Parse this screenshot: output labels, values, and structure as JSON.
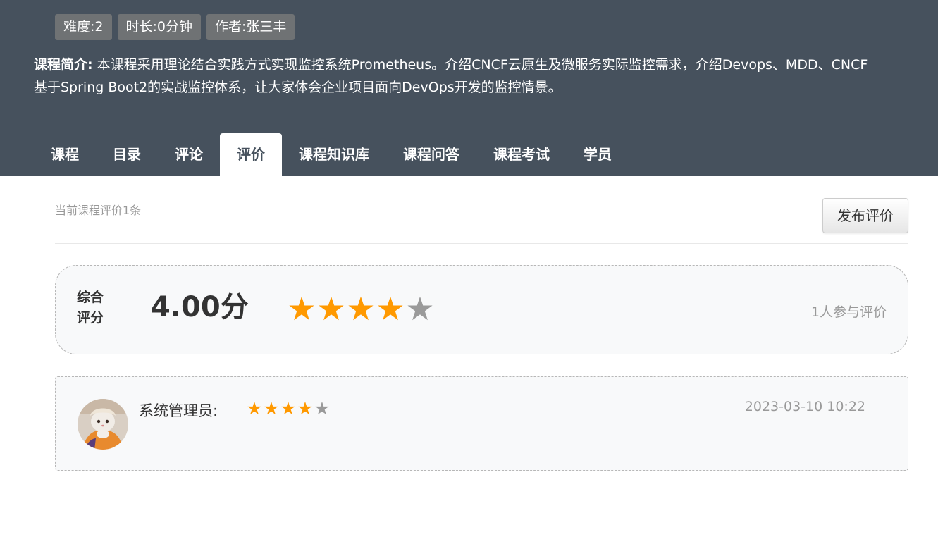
{
  "course": {
    "tags": [
      "难度:2",
      "时长:0分钟",
      "作者:张三丰"
    ],
    "intro_label": "课程简介:",
    "intro_line1": " 本课程采用理论结合实践方式实现监控系统Prometheus。介绍CNCF云原生及微服务实际监控需求，介绍Devops、MDD、CNCF",
    "intro_line2": "基于Spring Boot2的实战监控体系，让大家体会企业项目面向DevOps开发的监控情景。"
  },
  "tabs": [
    {
      "label": "课程",
      "active": false
    },
    {
      "label": "目录",
      "active": false
    },
    {
      "label": "评论",
      "active": false
    },
    {
      "label": "评价",
      "active": true
    },
    {
      "label": "课程知识库",
      "active": false
    },
    {
      "label": "课程问答",
      "active": false
    },
    {
      "label": "课程考试",
      "active": false
    },
    {
      "label": "学员",
      "active": false
    }
  ],
  "evaluation": {
    "count_text": "当前课程评价1条",
    "publish_label": "发布评价",
    "summary": {
      "label": "综合评分",
      "score_text": "4.00分",
      "rating": 4,
      "max_rating": 5,
      "participants_text": "1人参与评价"
    },
    "reviews": [
      {
        "reviewer": "系统管理员:",
        "rating": 4,
        "max_rating": 5,
        "time": "2023-03-10 10:22"
      }
    ]
  },
  "colors": {
    "header_bg": "#46515d",
    "star_on": "#ff9900",
    "star_off": "#9a9a9a"
  }
}
